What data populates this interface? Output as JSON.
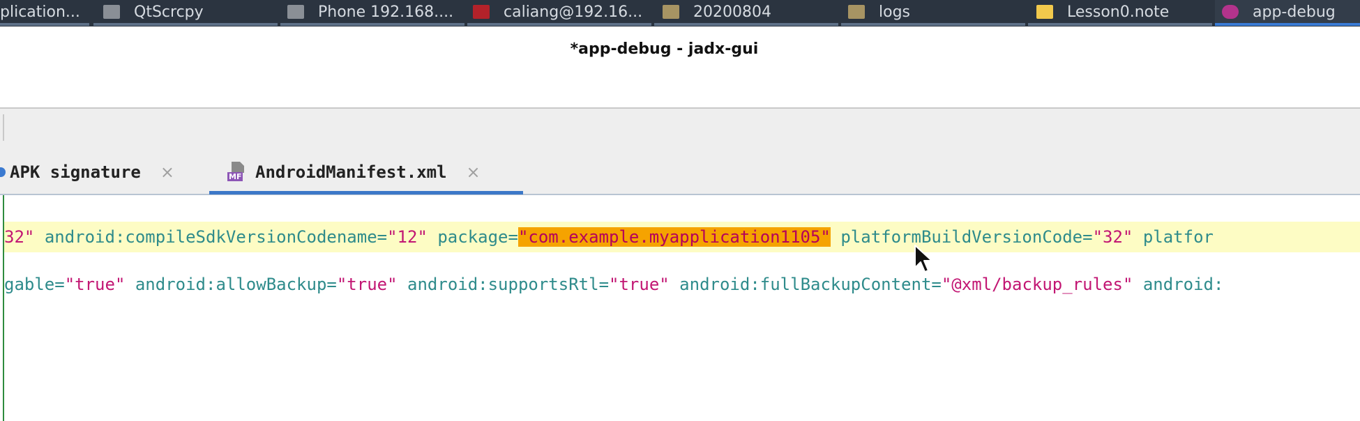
{
  "taskbar": {
    "items": [
      {
        "label": "plication..."
      },
      {
        "label": "QtScrcpy"
      },
      {
        "label": "Phone 192.168...."
      },
      {
        "label": "caliang@192.16..."
      },
      {
        "label": "20200804"
      },
      {
        "label": "logs"
      },
      {
        "label": "Lesson0.note"
      },
      {
        "label": "app-debug"
      }
    ]
  },
  "window": {
    "title": "*app-debug - jadx-gui"
  },
  "tabs": [
    {
      "label": "APK signature",
      "close": "×"
    },
    {
      "label": "AndroidManifest.xml",
      "close": "×",
      "icon_label": "MF"
    }
  ],
  "code": {
    "line1": {
      "t0": "32\"",
      "a1": "android:compileSdkVersionCodename",
      "v1": "\"12\"",
      "a2": "package",
      "v2": "\"com.example.myapplication1105\"",
      "a3": "platformBuildVersionCode",
      "v3": "\"32\"",
      "a4": "platfor"
    },
    "line2": {
      "a0": "gable",
      "v0": "\"true\"",
      "a1": "android:allowBackup",
      "v1": "\"true\"",
      "a2": "android:supportsRtl",
      "v2": "\"true\"",
      "a3": "android:fullBackupContent",
      "v3": "\"@xml/backup_rules\"",
      "a4": "android:"
    }
  },
  "colors": {
    "selection": "#f5a300",
    "attribute": "#2e8b8b",
    "value": "#c21673",
    "line_highlight": "#fdfcc4"
  }
}
